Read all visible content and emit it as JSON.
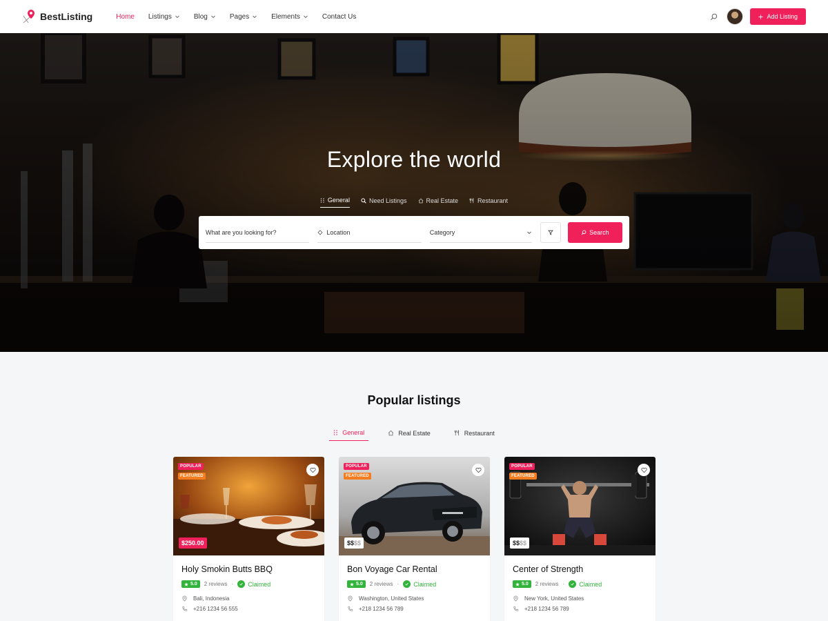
{
  "brand": {
    "name": "BestListing",
    "accent": "#f0205b"
  },
  "nav": [
    {
      "label": "Home",
      "active": true,
      "dropdown": false
    },
    {
      "label": "Listings",
      "dropdown": true
    },
    {
      "label": "Blog",
      "dropdown": true
    },
    {
      "label": "Pages",
      "dropdown": true
    },
    {
      "label": "Elements",
      "dropdown": true
    },
    {
      "label": "Contact Us",
      "dropdown": false
    }
  ],
  "header": {
    "add_listing_label": "Add Listing"
  },
  "hero": {
    "title": "Explore the world",
    "tabs": [
      {
        "label": "General",
        "icon": "grid-icon"
      },
      {
        "label": "Need Listings",
        "icon": "search-icon"
      },
      {
        "label": "Real Estate",
        "icon": "home-icon"
      },
      {
        "label": "Restaurant",
        "icon": "fork-knife-icon"
      }
    ],
    "search": {
      "what_placeholder": "What are you looking for?",
      "location_placeholder": "Location",
      "category_label": "Category",
      "button_label": "Search"
    }
  },
  "popular": {
    "title": "Popular listings",
    "tabs": [
      {
        "label": "General",
        "icon": "grid-icon"
      },
      {
        "label": "Real Estate",
        "icon": "home-icon"
      },
      {
        "label": "Restaurant",
        "icon": "fork-knife-icon"
      }
    ],
    "badge_popular": "POPULAR",
    "badge_featured": "FEATURED",
    "cards": [
      {
        "title": "Holy Smokin Butts BBQ",
        "price": "$250.00",
        "rating": "5.0",
        "reviews": "2 reviews",
        "claimed": "Claimed",
        "location": "Bali, Indonesia",
        "phone": "+216 1234 56 555"
      },
      {
        "title": "Bon Voyage Car Rental",
        "price_strong": "$$",
        "price_dim": "$$",
        "rating": "5.0",
        "reviews": "2 reviews",
        "claimed": "Claimed",
        "location": "Washington, United States",
        "phone": "+218 1234 56 789"
      },
      {
        "title": "Center of Strength",
        "price_strong": "$$",
        "price_dim": "$$",
        "rating": "5.0",
        "reviews": "2 reviews",
        "claimed": "Claimed",
        "location": "New York, United States",
        "phone": "+218 1234 56 789"
      }
    ]
  }
}
